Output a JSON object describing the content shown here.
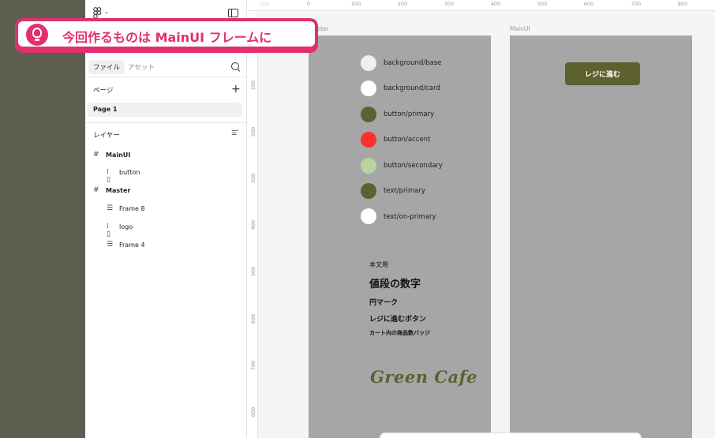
{
  "sidebar": {
    "tabs": [
      "ファイル",
      "アセット"
    ],
    "pages_title": "ページ",
    "page_item": "Page 1",
    "layers_title": "レイヤー",
    "layers": [
      {
        "label": "MainUI",
        "kind": "frame"
      },
      {
        "label": "button",
        "kind": "component"
      },
      {
        "label": "Master",
        "kind": "frame"
      },
      {
        "label": "Frame 8",
        "kind": "auto-layout"
      },
      {
        "label": "logo",
        "kind": "component"
      },
      {
        "label": "Frame 4",
        "kind": "auto-layout"
      }
    ]
  },
  "canvas": {
    "ruler_x": [
      "100",
      "0",
      "100",
      "200",
      "300",
      "400",
      "500",
      "600",
      "700",
      "800"
    ],
    "ruler_y": [
      "100",
      "200",
      "300",
      "400",
      "500",
      "600",
      "700",
      "800"
    ],
    "frame_labels": [
      "Master",
      "MainUI"
    ],
    "colors": [
      {
        "label": "background/base",
        "hex": "#f1efe6"
      },
      {
        "label": "background/card",
        "hex": "#ffffff"
      },
      {
        "label": "button/primary",
        "hex": "#5d6130"
      },
      {
        "label": "button/accent",
        "hex": "#ff3030"
      },
      {
        "label": "button/secondary",
        "hex": "#b8d4a0"
      },
      {
        "label": "text/primary",
        "hex": "#5d6130"
      },
      {
        "label": "text/on-primary",
        "hex": "#ffffff"
      }
    ],
    "typography": [
      "本文用",
      "値段の数字",
      "円マーク",
      "レジに進むボタン",
      "カート内の商品数バッジ"
    ],
    "logo_text": "Green Cafe",
    "register_button": "レジに進む"
  },
  "callout": {
    "text": "今回作るものは MainUI フレームに"
  }
}
